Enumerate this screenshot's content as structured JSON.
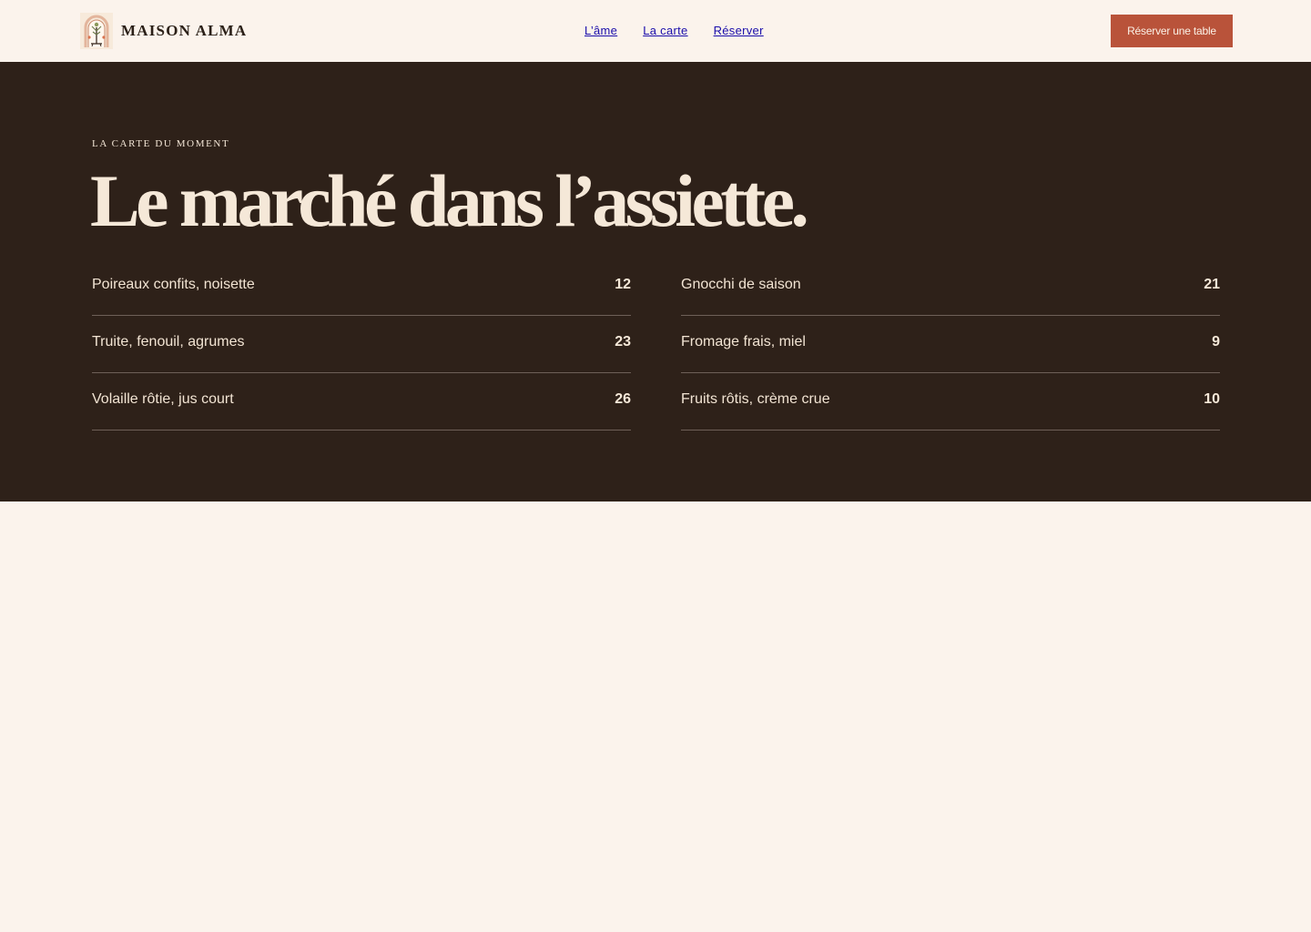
{
  "header": {
    "brand_name": "MAISON ALMA",
    "logo_icon": "arch-tree-logo",
    "nav": [
      {
        "label": "L’âme"
      },
      {
        "label": "La carte"
      },
      {
        "label": "Réserver"
      }
    ],
    "cta_label": "Réserver une table"
  },
  "hero": {
    "eyebrow": "LA CARTE DU MOMENT",
    "title": "Le marché dans l’assiette.",
    "menu_left": [
      {
        "dish": "Poireaux confits, noisette",
        "price": "12"
      },
      {
        "dish": "Truite, fenouil, agrumes",
        "price": "23"
      },
      {
        "dish": "Volaille rôtie, jus court",
        "price": "26"
      }
    ],
    "menu_right": [
      {
        "dish": "Gnocchi de saison",
        "price": "21"
      },
      {
        "dish": "Fromage frais, miel",
        "price": "9"
      },
      {
        "dish": "Fruits rôtis, crème crue",
        "price": "10"
      }
    ]
  },
  "colors": {
    "page_bg": "#fbf3ec",
    "hero_bg": "#2e2119",
    "accent": "#b9533a",
    "link": "#1a0dab",
    "cream_text": "#f5e8d8"
  }
}
